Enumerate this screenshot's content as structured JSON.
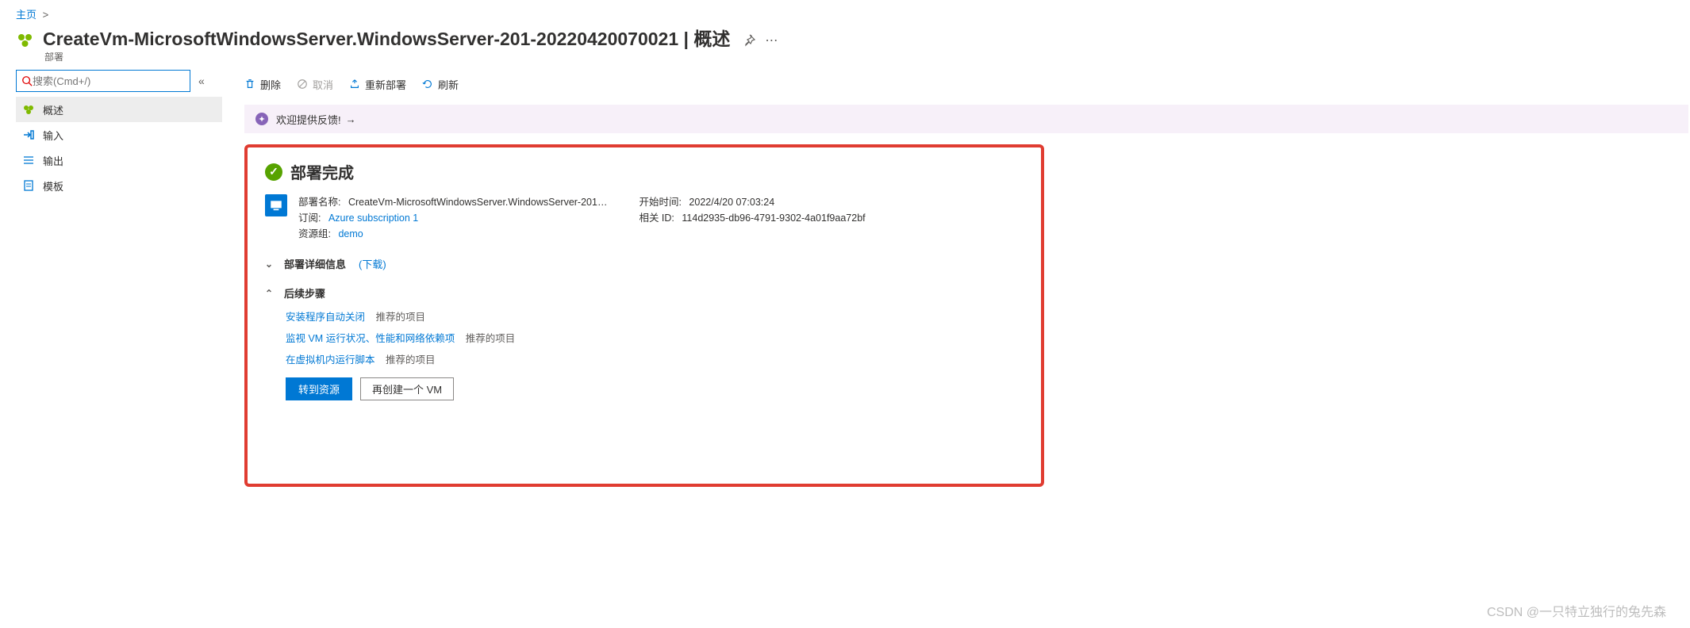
{
  "breadcrumb": {
    "home": "主页",
    "sep": ">"
  },
  "header": {
    "title": "CreateVm-MicrosoftWindowsServer.WindowsServer-201-20220420070021 | 概述",
    "subtitle": "部署"
  },
  "search": {
    "placeholder": "搜索(Cmd+/)"
  },
  "sidebar": {
    "items": [
      {
        "label": "概述"
      },
      {
        "label": "输入"
      },
      {
        "label": "输出"
      },
      {
        "label": "模板"
      }
    ]
  },
  "toolbar": {
    "delete": "删除",
    "cancel": "取消",
    "redeploy": "重新部署",
    "refresh": "刷新"
  },
  "feedback": {
    "text": "欢迎提供反馈!",
    "arrow": "→"
  },
  "deploy": {
    "status": "部署完成",
    "left": {
      "name_label": "部署名称:",
      "name_value": "CreateVm-MicrosoftWindowsServer.WindowsServer-201…",
      "sub_label": "订阅:",
      "sub_value": "Azure subscription 1",
      "rg_label": "资源组:",
      "rg_value": "demo"
    },
    "right": {
      "start_label": "开始时间:",
      "start_value": "2022/4/20 07:03:24",
      "corr_label": "相关 ID:",
      "corr_value": "114d2935-db96-4791-9302-4a01f9aa72bf"
    },
    "details": {
      "label": "部署详细信息",
      "download": "(下载)"
    },
    "next": {
      "label": "后续步骤",
      "items": [
        {
          "link": "安装程序自动关闭",
          "rec": "推荐的项目"
        },
        {
          "link": "监视 VM 运行状况、性能和网络依赖项",
          "rec": "推荐的项目"
        },
        {
          "link": "在虚拟机内运行脚本",
          "rec": "推荐的项目"
        }
      ]
    },
    "buttons": {
      "go": "转到资源",
      "another": "再创建一个 VM"
    }
  },
  "watermark": "CSDN @一只特立独行的兔先森"
}
